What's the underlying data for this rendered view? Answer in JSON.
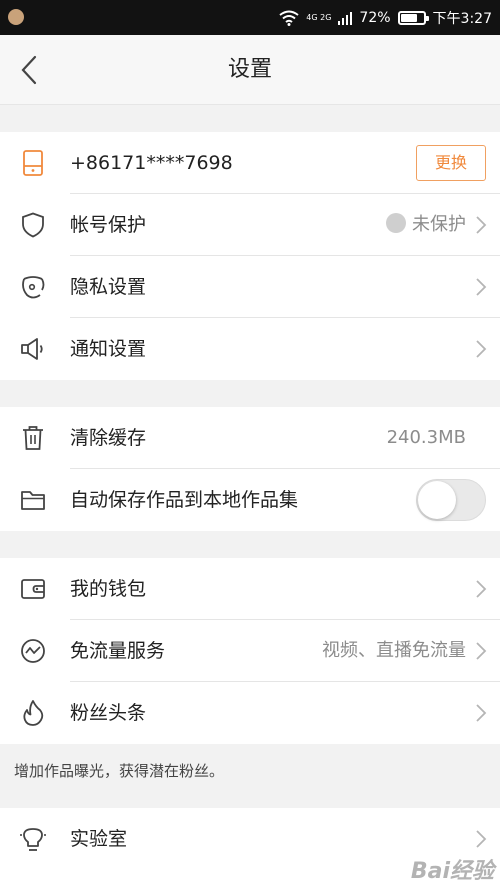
{
  "status_bar": {
    "network": "4G 2G",
    "battery_text": "72%",
    "battery_level": 0.72,
    "time": "下午3:27"
  },
  "nav": {
    "title": "设置",
    "back_icon": "chevron-left-icon"
  },
  "account": {
    "phone": "+86171****7698",
    "change_label": "更换",
    "protect_label": "帐号保护",
    "protect_status": "未保护",
    "privacy_label": "隐私设置",
    "notify_label": "通知设置"
  },
  "storage": {
    "cache_label": "清除缓存",
    "cache_size": "240.3MB",
    "autosave_label": "自动保存作品到本地作品集",
    "autosave_on": false
  },
  "services": {
    "wallet_label": "我的钱包",
    "freeflow_label": "免流量服务",
    "freeflow_value": "视频、直播免流量",
    "fans_label": "粉丝头条"
  },
  "note": "增加作品曝光，获得潜在粉丝。",
  "lab": {
    "label": "实验室"
  },
  "watermark": "Bai经验",
  "colors": {
    "accent": "#f0893c",
    "muted": "#8c8c8c",
    "background": "#f2f2f2"
  }
}
